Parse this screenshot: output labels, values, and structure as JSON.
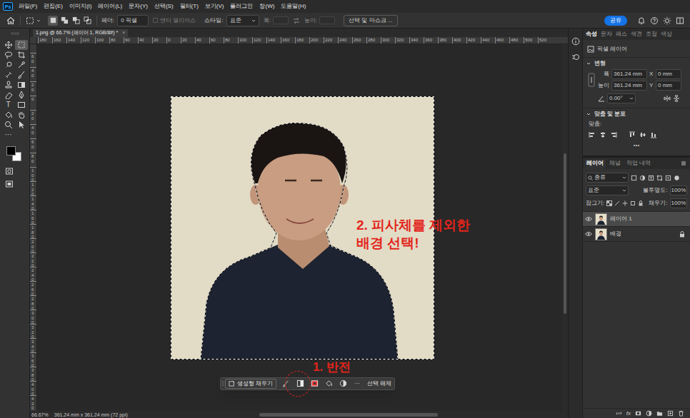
{
  "app": {
    "logo": "Ps"
  },
  "menu": [
    "파일(F)",
    "편집(E)",
    "이미지(I)",
    "레이어(L)",
    "문자(Y)",
    "선택(S)",
    "필터(T)",
    "보기(V)",
    "플러그인",
    "창(W)",
    "도움말(H)"
  ],
  "options_bar": {
    "feather_label": "페더:",
    "feather_value": "0 픽셀",
    "antialias": {
      "label": "앤티 앨리어스",
      "disabled": true
    },
    "style_label": "스타일:",
    "style_value": "표준",
    "width_label": "폭:",
    "height_label": "높이:",
    "select_mask": "선택 및 마스크 ...",
    "share": "공유"
  },
  "selection_modes": [
    {
      "selected": true
    },
    {
      "selected": false
    },
    {
      "selected": false
    },
    {
      "selected": false
    }
  ],
  "tools": [
    {
      "kind": "move",
      "selected": false
    },
    {
      "kind": "marquee",
      "selected": true
    },
    {
      "kind": "lasso",
      "selected": false
    },
    {
      "kind": "crop",
      "selected": false
    },
    {
      "kind": "quickselect",
      "selected": false
    },
    {
      "kind": "eyedropper",
      "selected": false
    },
    {
      "kind": "healing",
      "selected": false
    },
    {
      "kind": "brush",
      "selected": false
    },
    {
      "kind": "stamp",
      "selected": false
    },
    {
      "kind": "gradient",
      "selected": false
    },
    {
      "kind": "eraser",
      "selected": false
    },
    {
      "kind": "pen",
      "selected": false
    },
    {
      "kind": "type",
      "glyph": "T",
      "selected": false
    },
    {
      "kind": "rectangle",
      "selected": false
    },
    {
      "kind": "bucket",
      "selected": false
    },
    {
      "kind": "hand",
      "selected": false
    },
    {
      "kind": "zoom",
      "selected": false
    },
    {
      "kind": "pathselect",
      "selected": false
    },
    {
      "kind": "more",
      "glyph": "···",
      "selected": false
    }
  ],
  "swatches": {
    "foreground": "#000000",
    "background": "#ffffff"
  },
  "document_tab": {
    "title": "1.png @ 66.7% (레이어 1, RGB/8#) *",
    "close": "×"
  },
  "ruler": {
    "horizontal": [
      "180",
      "160",
      "140",
      "120",
      "100",
      "80",
      "60",
      "40",
      "20",
      "0",
      "20",
      "40",
      "60",
      "80",
      "100",
      "120",
      "140",
      "160",
      "180",
      "200",
      "220",
      "240",
      "260",
      "280",
      "300",
      "320",
      "340",
      "360",
      "380",
      "400",
      "420",
      "440",
      "460",
      "480",
      "500",
      "520"
    ],
    "vertical": [
      "60",
      "40",
      "20",
      "0",
      "20",
      "40",
      "60",
      "80",
      "100",
      "120",
      "140",
      "160",
      "180",
      "200",
      "220",
      "240",
      "260",
      "280",
      "300",
      "320",
      "340",
      "360",
      "380",
      "400",
      "420"
    ]
  },
  "selection": {
    "active": true
  },
  "contextual_bar": {
    "generative_fill": "생성형 채우기",
    "more": "···",
    "deselect": "선택 해제"
  },
  "annotations": {
    "step1": "1. 반전",
    "step2": [
      "2. 피사체를 제외한",
      "배경 선택!"
    ]
  },
  "status_bar": {
    "zoom": "66.67%",
    "info": "361.24 mm x 361.24 mm (72 ppi)"
  },
  "properties": {
    "tabs": [
      {
        "label": "속성",
        "selected": true
      },
      {
        "label": "문자",
        "selected": false
      },
      {
        "label": "패스",
        "selected": false
      },
      {
        "label": "색견",
        "selected": false
      },
      {
        "label": "조정",
        "selected": false
      },
      {
        "label": "색상",
        "selected": false
      }
    ],
    "layer_kind": "픽셀 레이어",
    "transform": {
      "title": "변형",
      "expanded": true,
      "width_label": "폭",
      "width": "361.24 mm",
      "x_label": "X",
      "x": "0 mm",
      "height_label": "높이",
      "height": "361.24 mm",
      "y_label": "Y",
      "y": "0 mm",
      "angle": "0.00°"
    },
    "align": {
      "title": "맞춤 및 분포",
      "expanded": true,
      "label": "맞춤:",
      "more": "•••"
    }
  },
  "layers_panel": {
    "tabs": [
      {
        "label": "레이어",
        "selected": true
      },
      {
        "label": "채널",
        "selected": false
      },
      {
        "label": "작업 내역",
        "selected": false
      }
    ],
    "filter": "종류",
    "blend_mode": "표준",
    "opacity_label": "불투명도:",
    "opacity": "100%",
    "lock_label": "잠그기:",
    "fill_label": "채우기:",
    "fill": "100%",
    "layers": [
      {
        "name": "레이어 1",
        "selected": true,
        "visible": true,
        "locked": false
      },
      {
        "name": "배경",
        "selected": false,
        "visible": true,
        "locked": true
      }
    ],
    "footer_fx": "fx"
  }
}
